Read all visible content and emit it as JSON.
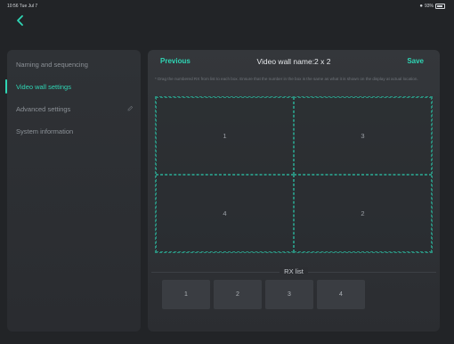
{
  "status_bar": {
    "time": "10:56  Tue Jul 7",
    "battery": "93%"
  },
  "sidebar": {
    "items": [
      {
        "label": "Naming and sequencing",
        "active": false
      },
      {
        "label": "Video wall settings",
        "active": true
      },
      {
        "label": "Advanced settings",
        "active": false
      },
      {
        "label": "System information",
        "active": false
      }
    ]
  },
  "panel": {
    "previous_label": "Previous",
    "title": "Video wall name:2 x 2",
    "save_label": "Save",
    "hint": "* Drag the numbered RX from list to each box. Ensure that the number in the box is the same as what it is shown on the display at actual location.",
    "grid": {
      "rows": 2,
      "cols": 2,
      "cells": [
        "1",
        "3",
        "4",
        "2"
      ]
    },
    "rx_list_title": "RX list",
    "rx_items": [
      "1",
      "2",
      "3",
      "4"
    ]
  },
  "colors": {
    "accent": "#2fd6b5",
    "background": "#222427",
    "panel": "#303337"
  }
}
